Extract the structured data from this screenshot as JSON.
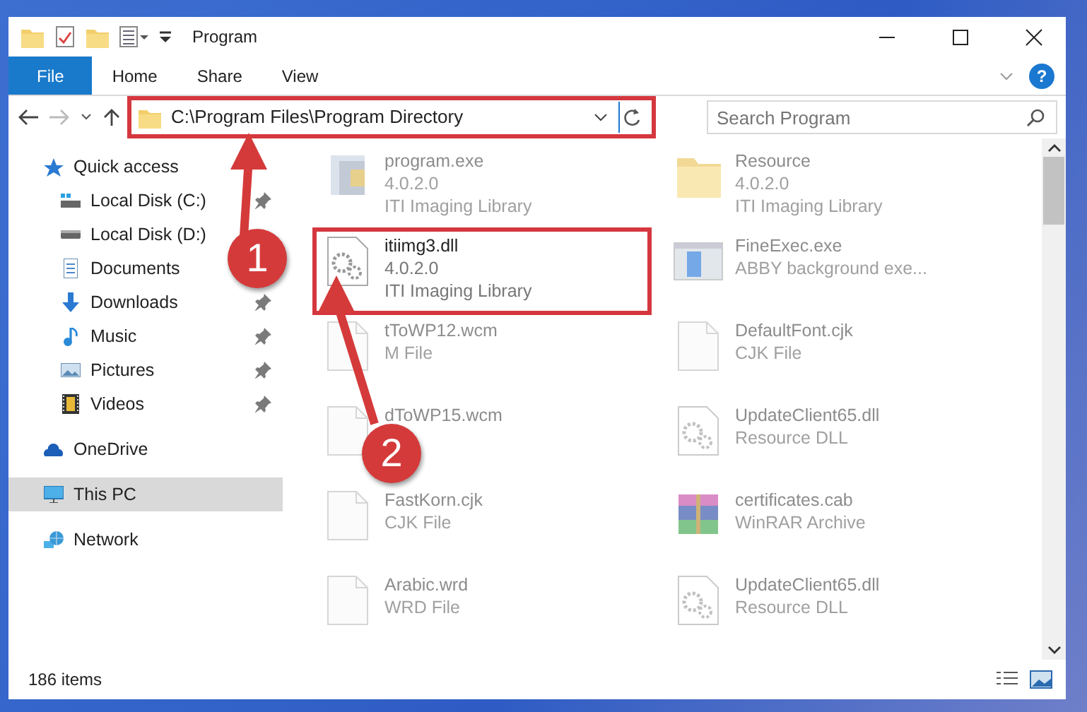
{
  "window": {
    "title": "Program"
  },
  "ribbon_tabs": [
    {
      "label": "File",
      "selected": true
    },
    {
      "label": "Home",
      "selected": false
    },
    {
      "label": "Share",
      "selected": false
    },
    {
      "label": "View",
      "selected": false
    }
  ],
  "address": {
    "path": "C:\\Program Files\\Program Directory",
    "highlighted": true
  },
  "search": {
    "placeholder": "Search Program"
  },
  "help": {
    "label": "?"
  },
  "navigation": [
    {
      "label": "Quick access",
      "kind": "star",
      "selected": false,
      "children": [
        {
          "label": "Local Disk (C:)",
          "kind": "drive-c",
          "pinned": true,
          "selected": false
        },
        {
          "label": "Local Disk (D:)",
          "kind": "drive",
          "pinned": false,
          "selected": false
        },
        {
          "label": "Documents",
          "kind": "documents",
          "pinned": false,
          "selected": false
        },
        {
          "label": "Downloads",
          "kind": "downloads",
          "pinned": true,
          "selected": false
        },
        {
          "label": "Music",
          "kind": "music",
          "pinned": true,
          "selected": false
        },
        {
          "label": "Pictures",
          "kind": "pictures",
          "pinned": true,
          "selected": false
        },
        {
          "label": "Videos",
          "kind": "videos",
          "pinned": true,
          "selected": false
        }
      ]
    },
    {
      "label": "OneDrive",
      "kind": "cloud",
      "selected": false
    },
    {
      "label": "This PC",
      "kind": "pc",
      "selected": true
    },
    {
      "label": "Network",
      "kind": "network",
      "selected": false
    }
  ],
  "files": [
    {
      "name": "program.exe",
      "lines": [
        "4.0.2.0",
        "ITI Imaging Library"
      ],
      "kind": "app",
      "highlighted": false
    },
    {
      "name": "Resource",
      "lines": [
        "4.0.2.0",
        "ITI Imaging Library"
      ],
      "kind": "folder",
      "highlighted": false
    },
    {
      "name": "itiimg3.dll",
      "lines": [
        "4.0.2.0",
        "ITI Imaging Library"
      ],
      "kind": "dll",
      "highlighted": true
    },
    {
      "name": "FineExec.exe",
      "lines": [
        "ABBY background exe..."
      ],
      "kind": "window",
      "highlighted": false
    },
    {
      "name": "tToWP12.wcm",
      "lines": [
        "M File"
      ],
      "kind": "blank",
      "highlighted": false
    },
    {
      "name": "DefaultFont.cjk",
      "lines": [
        "CJK File"
      ],
      "kind": "blank",
      "highlighted": false
    },
    {
      "name": "dToWP15.wcm",
      "kind": "blank",
      "highlighted": false
    },
    {
      "name": "UpdateClient65.dll",
      "lines": [
        "Resource DLL"
      ],
      "kind": "dll",
      "highlighted": false
    },
    {
      "name": "FastKorn.cjk",
      "lines": [
        "CJK File"
      ],
      "kind": "blank",
      "highlighted": false
    },
    {
      "name": "certificates.cab",
      "lines": [
        "WinRAR Archive"
      ],
      "kind": "archive",
      "highlighted": false
    },
    {
      "name": "Arabic.wrd",
      "lines": [
        "WRD File"
      ],
      "kind": "blank",
      "highlighted": false
    },
    {
      "name": "UpdateClient65.dll",
      "lines": [
        "Resource DLL"
      ],
      "kind": "dll",
      "highlighted": false
    }
  ],
  "annotations": [
    {
      "label": "1"
    },
    {
      "label": "2"
    }
  ],
  "status_bar": {
    "count": "186 items"
  }
}
